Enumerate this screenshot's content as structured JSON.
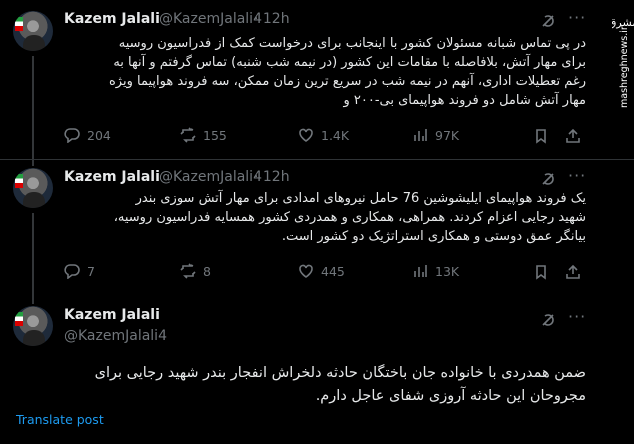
{
  "tweets": [
    {
      "name": "Kazem Jalali",
      "handle": "@KazemJalali4",
      "time": "· 12h",
      "lines": [
        "در پی تماس شبانه مسئولان کشور با اینجانب برای درخواست کمک از فدراسیون روسیه",
        "برای مهار آتش، بلافاصله با مقامات این کشور (در نیمه شب شنبه) تماس گرفتم و آنها به",
        "رغم تعطیلات اداری، آنهم در نیمه شب در سریع ترین زمان ممکن، سه فروند هواپیما ویژه",
        "مهار آتش شامل دو فروند هواپیمای بی-۲۰۰ و"
      ],
      "replies": "204",
      "retweets": "155",
      "likes": "1.4K",
      "views": "97K"
    },
    {
      "name": "Kazem Jalali",
      "handle": "@KazemJalali4",
      "time": "· 12h",
      "lines": [
        "یک فروند هواپیمای ایلیشوشین 76 حامل نیروهای امدادی برای مهار آتش سوزی بندر",
        "شهید رجایی اعزام کردند. همراهی، همکاری و همدردی کشور همسایه فدراسیون روسیه،",
        "بیانگر عمق دوستی و همکاری استراتژیک دو کشور است."
      ],
      "replies": "7",
      "retweets": "8",
      "likes": "445",
      "views": "13K"
    },
    {
      "name": "Kazem Jalali",
      "handle": "@KazemJalali4",
      "lines": [
        "ضمن همدردی با خانواده جان باختگان حادثه دلخراش انفجار بندر شهید رجایی برای",
        "مجروحان این حادثه آروزی شفای عاجل دارم."
      ],
      "translate": "Translate post"
    }
  ],
  "watermark": {
    "brand": "مشرق",
    "site": "mashreghnews.ir"
  },
  "colors": {
    "background": "#000000",
    "text": "#e7e9ea",
    "muted": "#71767b",
    "link": "#1d9bf0"
  },
  "icons": [
    "grok-icon",
    "more-icon",
    "reply-icon",
    "retweet-icon",
    "like-icon",
    "views-icon",
    "bookmark-icon",
    "share-icon"
  ]
}
